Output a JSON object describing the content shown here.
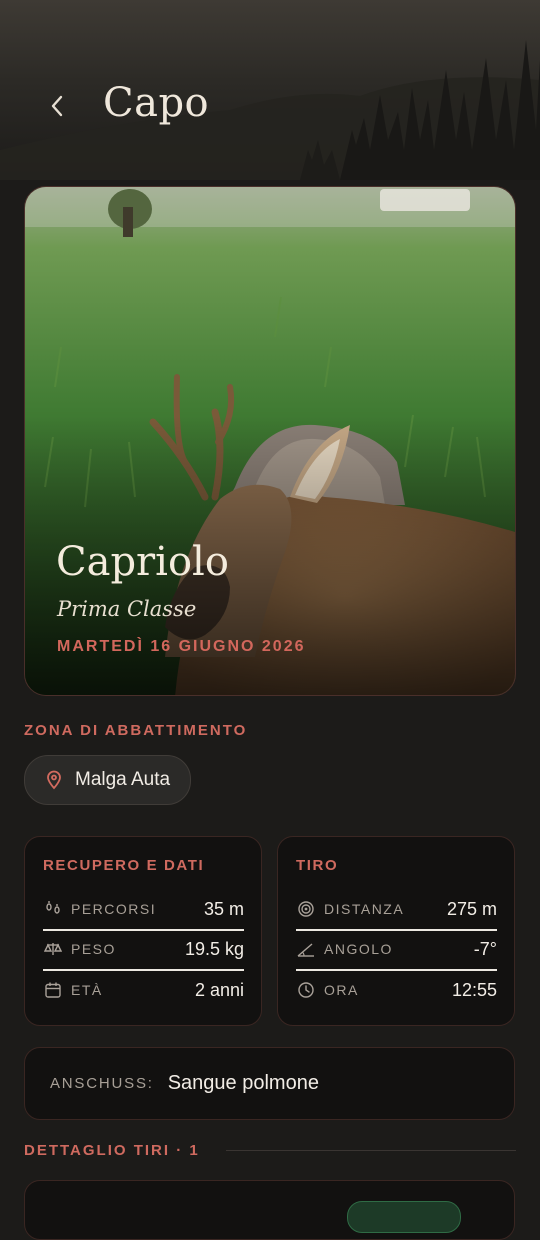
{
  "header": {
    "title": "Capo",
    "back_icon": "chevron-left-icon"
  },
  "hero": {
    "species": "Capriolo",
    "class": "Prima Classe",
    "date": "MARTEDÌ 16 GIUGNO 2026"
  },
  "zone": {
    "label": "ZONA DI ABBATTIMENTO",
    "location": "Malga Auta",
    "icon": "map-pin-icon"
  },
  "recupero": {
    "title": "RECUPERO E DATI",
    "rows": [
      {
        "icon": "footprints-icon",
        "label": "PERCORSI",
        "value": "35 m"
      },
      {
        "icon": "scale-icon",
        "label": "PESO",
        "value": "19.5 kg"
      },
      {
        "icon": "calendar-icon",
        "label": "ETÀ",
        "value": "2 anni"
      }
    ]
  },
  "tiro": {
    "title": "TIRO",
    "rows": [
      {
        "icon": "target-icon",
        "label": "DISTANZA",
        "value": "275 m"
      },
      {
        "icon": "angle-icon",
        "label": "ANGOLO",
        "value": "-7°"
      },
      {
        "icon": "clock-icon",
        "label": "ORA",
        "value": "12:55"
      }
    ]
  },
  "anschuss": {
    "label": "ANSCHUSS:",
    "value": "Sangue polmone"
  },
  "details": {
    "label": "DETTAGLIO TIRI · 1"
  },
  "colors": {
    "accent": "#cf6a5f",
    "background": "#1c1b19",
    "card": "#121110",
    "text": "#f2ede6"
  }
}
